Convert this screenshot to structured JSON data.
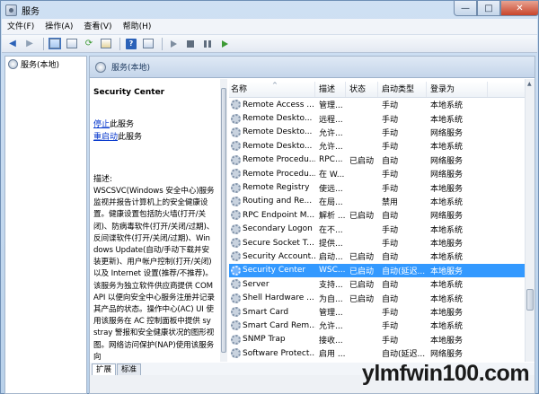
{
  "window": {
    "title": "服务",
    "controls": {
      "minimize": "—",
      "maximize": "□",
      "close": "✕"
    }
  },
  "menubar": {
    "items": [
      "文件(F)",
      "操作(A)",
      "查看(V)",
      "帮助(H)"
    ]
  },
  "toolbar": {
    "icons": [
      "back-arrow-icon",
      "forward-arrow-icon",
      "console-tree-icon",
      "show-hide-icon",
      "refresh-icon",
      "export-list-icon",
      "help-icon",
      "show-action-pane-icon",
      "start-service-icon",
      "stop-service-icon",
      "pause-service-icon",
      "restart-service-icon"
    ],
    "help_glyph": "?"
  },
  "tree": {
    "items": [
      "服务(本地)"
    ]
  },
  "main": {
    "header": "服务(本地)",
    "detail": {
      "title": "Security Center",
      "stop_link": "停止",
      "stop_suffix": "此服务",
      "restart_link": "重启动",
      "restart_suffix": "此服务",
      "description_label": "描述:",
      "description": "WSCSVC(Windows 安全中心)服务监视并报告计算机上的安全健康设置。健康设置包括防火墙(打开/关闭)、防病毒软件(打开/关闭/过期)、反间谍软件(打开/关闭/过期)、Windows Update(自动/手动下载并安装更新)、用户帐户控制(打开/关闭)以及 Internet 设置(推荐/不推荐)。该服务为独立软件供应商提供 COM API 以便向安全中心服务注册并记录其产品的状态。操作中心(AC) UI 使用该服务在 AC 控制面板中提供 systray 警报和安全健康状况的图形视图。网络访问保护(NAP)使用该服务向"
    },
    "table": {
      "sort_glyph": "^",
      "columns": [
        "名称",
        "描述",
        "状态",
        "启动类型",
        "登录为"
      ],
      "rows": [
        [
          "Remote Access ...",
          "管理...",
          "",
          "手动",
          "本地系统"
        ],
        [
          "Remote Deskto...",
          "远程...",
          "",
          "手动",
          "本地系统"
        ],
        [
          "Remote Deskto...",
          "允许...",
          "",
          "手动",
          "网络服务"
        ],
        [
          "Remote Deskto...",
          "允许...",
          "",
          "手动",
          "本地系统"
        ],
        [
          "Remote Procedu...",
          "RPC...",
          "已启动",
          "自动",
          "网络服务"
        ],
        [
          "Remote Procedu...",
          "在 W...",
          "",
          "手动",
          "网络服务"
        ],
        [
          "Remote Registry",
          "使远...",
          "",
          "手动",
          "本地服务"
        ],
        [
          "Routing and Re...",
          "在局...",
          "",
          "禁用",
          "本地系统"
        ],
        [
          "RPC Endpoint M...",
          "解析 ...",
          "已启动",
          "自动",
          "网络服务"
        ],
        [
          "Secondary Logon",
          "在不...",
          "",
          "手动",
          "本地系统"
        ],
        [
          "Secure Socket T...",
          "提供...",
          "",
          "手动",
          "本地服务"
        ],
        [
          "Security Account...",
          "启动...",
          "已启动",
          "自动",
          "本地系统"
        ],
        [
          "Security Center",
          "WSC...",
          "已启动",
          "自动(延迟...",
          "本地服务"
        ],
        [
          "Server",
          "支持...",
          "已启动",
          "自动",
          "本地系统"
        ],
        [
          "Shell Hardware ...",
          "为自...",
          "已启动",
          "自动",
          "本地系统"
        ],
        [
          "Smart Card",
          "管理...",
          "",
          "手动",
          "本地服务"
        ],
        [
          "Smart Card Rem...",
          "允许...",
          "",
          "手动",
          "本地系统"
        ],
        [
          "SNMP Trap",
          "接收...",
          "",
          "手动",
          "本地服务"
        ],
        [
          "Software Protect...",
          "启用 ...",
          "",
          "自动(延迟...",
          "网络服务"
        ]
      ],
      "selected_index": 12
    },
    "tabs": [
      "扩展",
      "标准"
    ]
  },
  "watermark": "ylmfwin100.com",
  "colors": {
    "selection": "#3399ff",
    "link": "#0033cc",
    "close_button": "#c8442b"
  }
}
